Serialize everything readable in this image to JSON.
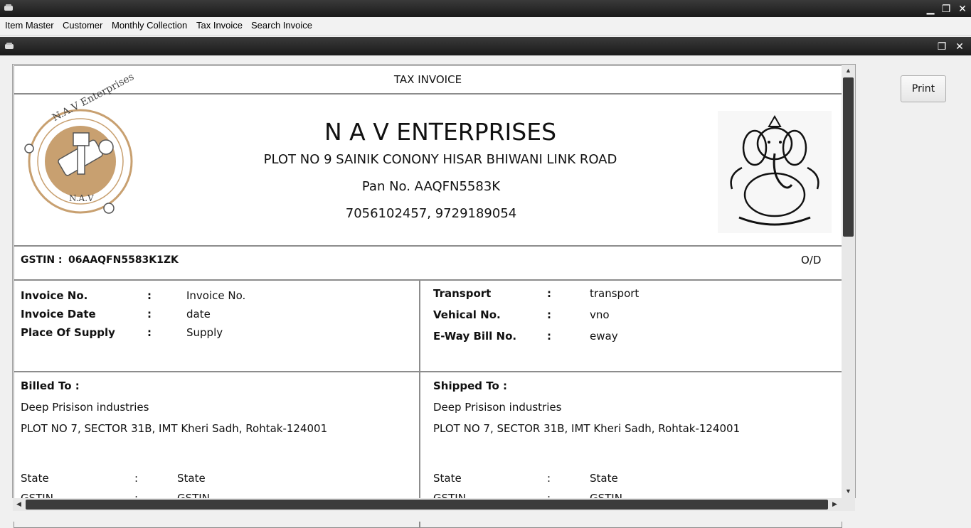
{
  "menu": {
    "items": [
      "Item Master",
      "Customer",
      "Monthly Collection",
      "Tax Invoice",
      "Search Invoice"
    ]
  },
  "window_controls": {
    "minimize": "▁",
    "restore": "❐",
    "close": "✕"
  },
  "actions": {
    "print_label": "Print"
  },
  "invoice": {
    "doc_title": "TAX INVOICE",
    "company": {
      "name": "N A V ENTERPRISES",
      "address": "PLOT NO 9 SAINIK CONONY HISAR BHIWANI LINK ROAD",
      "pan": "Pan No. AAQFN5583K",
      "phones": "7056102457, 9729189054",
      "logo_text_top": "N.A.V Enterprises",
      "logo_text_bottom": "N.A.V"
    },
    "gstin_label": "GSTIN :",
    "gstin_value": "06AAQFN5583K1ZK",
    "od_label": "O/D",
    "details_left": [
      {
        "label": "Invoice No.",
        "sep": ":",
        "value": "Invoice No."
      },
      {
        "label": "Invoice Date",
        "sep": ":",
        "value": "date"
      },
      {
        "label": "Place Of Supply",
        "sep": ":",
        "value": "Supply"
      }
    ],
    "details_right": [
      {
        "label": "Transport",
        "sep": ":",
        "value": "transport"
      },
      {
        "label": "Vehical No.",
        "sep": ":",
        "value": "vno"
      },
      {
        "label": "E-Way Bill No.",
        "sep": ":",
        "value": "eway"
      }
    ],
    "billed": {
      "heading": "Billed To :",
      "name": "Deep Prisison industries",
      "address": "PLOT NO 7, SECTOR 31B, IMT Kheri Sadh, Rohtak-124001",
      "state_label": "State",
      "state_sep": ":",
      "state_value": "State",
      "gstin_label": "GSTIN",
      "gstin_sep": ":",
      "gstin_value": "GSTIN"
    },
    "shipped": {
      "heading": "Shipped To :",
      "name": "Deep Prisison industries",
      "address": "PLOT NO 7, SECTOR 31B, IMT Kheri Sadh, Rohtak-124001",
      "state_label": "State",
      "state_sep": ":",
      "state_value": "State",
      "gstin_label": "GSTIN",
      "gstin_sep": ":",
      "gstin_value": "GSTIN"
    }
  },
  "colors": {
    "titlebar": "#1a1a1a",
    "logo_gold": "#c8a070",
    "scroll_thumb": "#3c3c3c"
  }
}
